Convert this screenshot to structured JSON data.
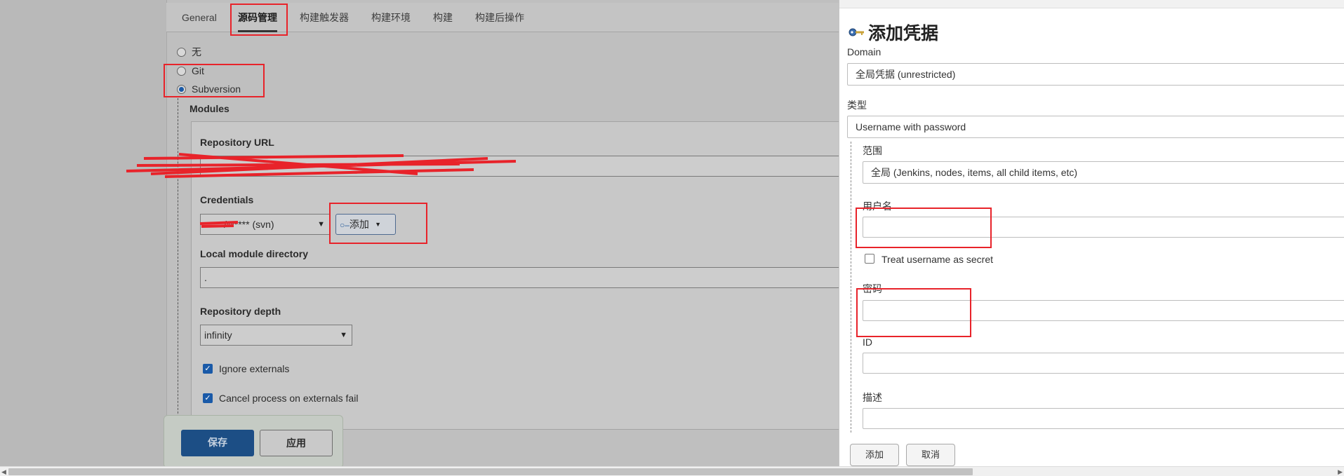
{
  "tabs": [
    {
      "label": "General"
    },
    {
      "label": "源码管理"
    },
    {
      "label": "构建触发器"
    },
    {
      "label": "构建环境"
    },
    {
      "label": "构建"
    },
    {
      "label": "构建后操作"
    }
  ],
  "scm": {
    "options": [
      {
        "label": "无",
        "selected": false
      },
      {
        "label": "Git",
        "selected": false
      },
      {
        "label": "Subversion",
        "selected": true
      }
    ],
    "modules_label": "Modules",
    "repo_url_label": "Repository URL",
    "credentials_label": "Credentials",
    "credentials_value": "/****** (svn)",
    "add_button_label": "添加",
    "local_dir_label": "Local module directory",
    "local_dir_value": ".",
    "depth_label": "Repository depth",
    "depth_value": "infinity",
    "ignore_externals_label": "Ignore externals",
    "ignore_externals_checked": true,
    "cancel_externals_label": "Cancel process on externals fail",
    "cancel_externals_checked": true
  },
  "footer": {
    "save_label": "保存",
    "apply_label": "应用"
  },
  "dialog": {
    "title": "添加凭据",
    "domain_label": "Domain",
    "domain_value": "全局凭据 (unrestricted)",
    "type_label": "类型",
    "type_value": "Username with password",
    "scope_label": "范围",
    "scope_value": "全局 (Jenkins, nodes, items, all child items, etc)",
    "username_label": "用户名",
    "username_value": "",
    "treat_secret_label": "Treat username as secret",
    "treat_secret_checked": false,
    "password_label": "密码",
    "password_value": "",
    "id_label": "ID",
    "id_value": "",
    "description_label": "描述",
    "description_value": "",
    "add_label": "添加",
    "cancel_label": "取消"
  },
  "colors": {
    "annotation_red": "#e8232a",
    "primary_blue": "#1a5aa8",
    "overlay_grey": "#b9b9b9"
  }
}
